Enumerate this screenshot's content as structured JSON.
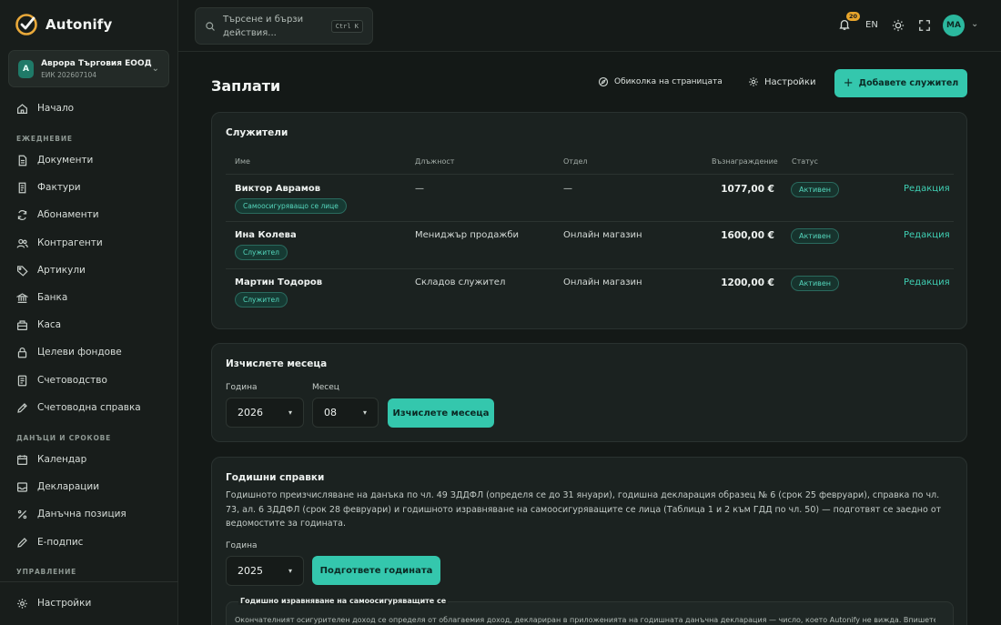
{
  "app": {
    "name": "Autonify"
  },
  "company": {
    "initial": "A",
    "name": "Аврора Търговия ЕООД",
    "eik": "ЕИК 202607104"
  },
  "sidebar": {
    "home": "Начало",
    "section_daily": "ЕЖЕДНЕВИЕ",
    "daily": [
      "Документи",
      "Фактури",
      "Абонаменти",
      "Контрагенти",
      "Артикули",
      "Банка",
      "Каса",
      "Целеви фондове",
      "Счетоводство",
      "Счетоводна справка"
    ],
    "section_tax": "ДАНЪЦИ И СРОКОВЕ",
    "tax": [
      "Календар",
      "Декларации",
      "Данъчна позиция",
      "Е-подпис"
    ],
    "section_manage": "УПРАВЛЕНИЕ",
    "settings": "Настройки"
  },
  "topbar": {
    "search_placeholder": "Търсене и бързи действия...",
    "search_shortcut": "Ctrl K",
    "notifications_count": "20",
    "language": "EN",
    "user_initials": "МА"
  },
  "page": {
    "title": "Заплати",
    "tour_label": "Обиколка на страницата",
    "settings_label": "Настройки",
    "add_employee_label": "Добавете служител"
  },
  "employees": {
    "title": "Служители",
    "columns": [
      "Име",
      "Длъжност",
      "Отдел",
      "Възнаграждение",
      "Статус"
    ],
    "rows": [
      {
        "name": "Виктор Аврамов",
        "type": "Самоосигуряващо се лице",
        "position": "—",
        "department": "—",
        "salary": "1077,00 €",
        "status": "Активен",
        "action": "Редакция"
      },
      {
        "name": "Ина Колева",
        "type": "Служител",
        "position": "Мениджър продажби",
        "department": "Онлайн магазин",
        "salary": "1600,00 €",
        "status": "Активен",
        "action": "Редакция"
      },
      {
        "name": "Мартин Тодоров",
        "type": "Служител",
        "position": "Складов служител",
        "department": "Онлайн магазин",
        "salary": "1200,00 €",
        "status": "Активен",
        "action": "Редакция"
      }
    ]
  },
  "calc_month": {
    "title": "Изчислете месеца",
    "year_label": "Година",
    "year_value": "2026",
    "month_label": "Месец",
    "month_value": "08",
    "button": "Изчислете месеца"
  },
  "annual": {
    "title": "Годишни справки",
    "description": "Годишното преизчисляване на данъка по чл. 49 ЗДДФЛ (определя се до 31 януари), годишна декларация образец № 6 (срок 25 февруари), справка по чл. 73, ал. 6 ЗДДФЛ (срок 28 февруари) и годишното изравняване на самоосигуряващите се лица (Таблица 1 и 2 към ГДД по чл. 50) — подготвят се заедно от ведомостите за годината.",
    "year_label": "Година",
    "year_value": "2025",
    "button": "Подгответе годината",
    "sub_title": "Годишно изравняване на самоосигуряващите се",
    "sub_text": "Окончателният осигурителен доход се определя от облагаемия доход, деклариран в приложенията на годишната данъчна декларация — число, което Autonify не вижда. Впишете го"
  }
}
